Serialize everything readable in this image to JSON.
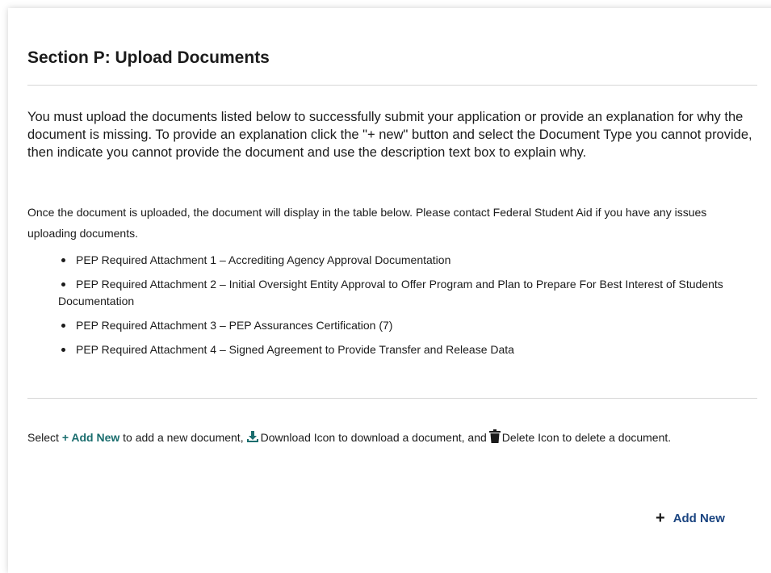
{
  "section": {
    "title": "Section P: Upload Documents",
    "intro": "You must upload the documents listed below to successfully submit your application or provide an explanation for why the document is missing. To provide an explanation click the \"+ new\" button and select the Document Type you cannot provide, then indicate you cannot provide the document and use the description text box to explain why.",
    "note": "Once the document is uploaded, the document will display in the table below. Please contact Federal Student Aid if you have any issues uploading documents."
  },
  "requirements": [
    "PEP Required Attachment 1 – Accrediting Agency Approval Documentation",
    "PEP Required Attachment 2 – Initial Oversight Entity Approval to Offer Program and Plan to Prepare For Best Interest of Students Documentation",
    "PEP Required Attachment 3 – PEP Assurances Certification (7)",
    "PEP Required Attachment 4 – Signed Agreement to Provide Transfer and Release Data"
  ],
  "instructions": {
    "select": "Select",
    "plus": "+",
    "add_new": "Add New",
    "part2": "to add a new document,",
    "download_icon_label": "Download Icon to download a document, and",
    "delete_icon_label": "Delete Icon to delete a document."
  },
  "actions": {
    "add_new_plus": "+",
    "add_new_label": "Add New"
  },
  "icons": {
    "download": "download-icon",
    "delete": "trash-icon",
    "add": "plus-icon"
  },
  "colors": {
    "link_teal": "#1a6d6e",
    "button_blue": "#1a4480",
    "text": "#1b1b1b",
    "divider": "#d6d6d6"
  }
}
